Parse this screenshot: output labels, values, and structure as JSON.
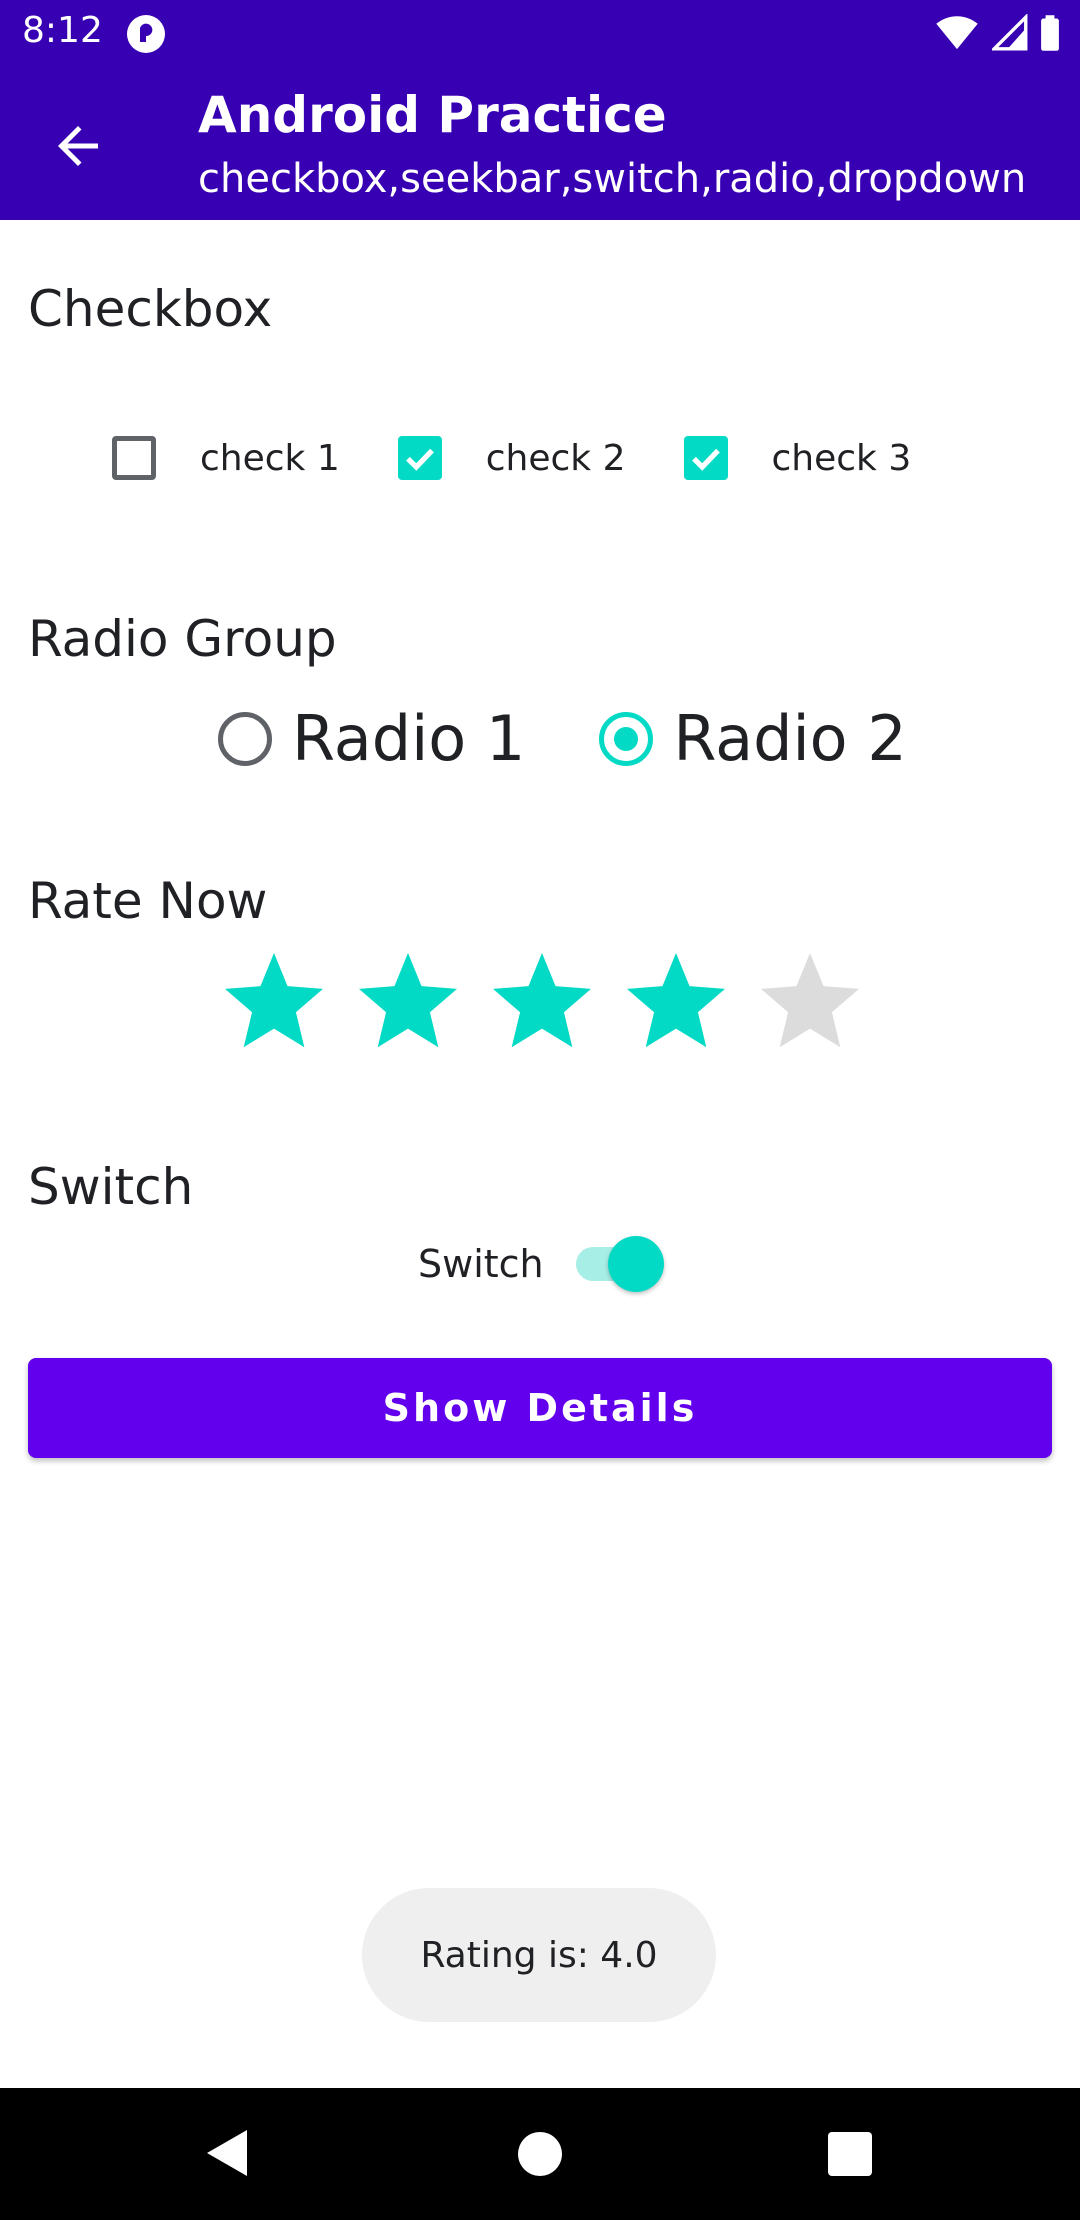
{
  "status_bar": {
    "time": "8:12"
  },
  "app_bar": {
    "title": "Android Practice",
    "subtitle": "checkbox,seekbar,switch,radio,dropdown"
  },
  "sections": {
    "checkbox": "Checkbox",
    "radio": "Radio Group",
    "rating": "Rate Now",
    "switch": "Switch"
  },
  "checkboxes": [
    {
      "label": "check 1",
      "checked": false
    },
    {
      "label": "check 2",
      "checked": true
    },
    {
      "label": "check 3",
      "checked": true
    }
  ],
  "radios": [
    {
      "label": "Radio 1",
      "checked": false
    },
    {
      "label": "Radio 2",
      "checked": true
    }
  ],
  "rating": {
    "value": 4,
    "max": 5
  },
  "switch": {
    "label": "Switch",
    "on": true
  },
  "details_button": {
    "label": "Show Details"
  },
  "toast": {
    "text": "Rating is: 4.0"
  },
  "colors": {
    "primary_dark": "#3700b3",
    "primary": "#6200ee",
    "accent": "#03dac5",
    "star_empty": "#dcdcdc"
  }
}
